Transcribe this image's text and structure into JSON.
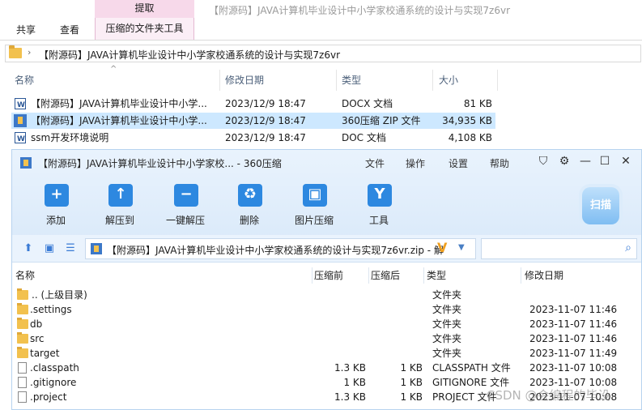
{
  "explorer": {
    "context_tab_header": "提取",
    "tabs": [
      "共享",
      "查看",
      "压缩的文件夹工具"
    ],
    "window_title": "【附源码】JAVA计算机毕业设计中小学家校通系统的设计与实现7z6vr",
    "address_path": "【附源码】JAVA计算机毕业设计中小学家校通系统的设计与实现7z6vr",
    "columns": [
      "名称",
      "修改日期",
      "类型",
      "大小"
    ],
    "files": [
      {
        "name": "【附源码】JAVA计算机毕业设计中小学...",
        "date": "2023/12/9 18:47",
        "type": "DOCX 文档",
        "size": "81 KB",
        "icon": "word-doc-icon"
      },
      {
        "name": "【附源码】JAVA计算机毕业设计中小学...",
        "date": "2023/12/9 18:47",
        "type": "360压缩 ZIP 文件",
        "size": "34,935 KB",
        "icon": "zip-archive-icon"
      },
      {
        "name": "ssm开发环境说明",
        "date": "2023/12/9 18:47",
        "type": "DOC 文档",
        "size": "4,108 KB",
        "icon": "word-doc-icon"
      }
    ]
  },
  "zip": {
    "title": "【附源码】JAVA计算机毕业设计中小学家校... - 360压缩",
    "menu": [
      "文件",
      "操作",
      "设置",
      "帮助"
    ],
    "toolbar": [
      {
        "label": "添加",
        "icon": "+"
      },
      {
        "label": "解压到",
        "icon": "↑"
      },
      {
        "label": "一键解压",
        "icon": "−"
      },
      {
        "label": "删除",
        "icon": "♻"
      },
      {
        "label": "图片压缩",
        "icon": "▣"
      },
      {
        "label": "工具",
        "icon": "Y"
      }
    ],
    "scan_label": "扫描",
    "address": "【附源码】JAVA计算机毕业设计中小学家校通系统的设计与实现7z6vr.zip - 解",
    "columns": [
      "名称",
      "压缩前",
      "压缩后",
      "类型",
      "修改日期"
    ],
    "rows": [
      {
        "name": ".. (上级目录)",
        "before": "",
        "after": "",
        "type": "文件夹",
        "date": "",
        "kind": "folder"
      },
      {
        "name": ".settings",
        "before": "",
        "after": "",
        "type": "文件夹",
        "date": "2023-11-07 11:46",
        "kind": "folder"
      },
      {
        "name": "db",
        "before": "",
        "after": "",
        "type": "文件夹",
        "date": "2023-11-07 11:46",
        "kind": "folder"
      },
      {
        "name": "src",
        "before": "",
        "after": "",
        "type": "文件夹",
        "date": "2023-11-07 11:46",
        "kind": "folder"
      },
      {
        "name": "target",
        "before": "",
        "after": "",
        "type": "文件夹",
        "date": "2023-11-07 11:49",
        "kind": "folder"
      },
      {
        "name": ".classpath",
        "before": "1.3 KB",
        "after": "1 KB",
        "type": "CLASSPATH 文件",
        "date": "2023-11-07 10:08",
        "kind": "file"
      },
      {
        "name": ".gitignore",
        "before": "1 KB",
        "after": "1 KB",
        "type": "GITIGNORE 文件",
        "date": "2023-11-07 10:08",
        "kind": "file"
      },
      {
        "name": ".project",
        "before": "1.3 KB",
        "after": "1 KB",
        "type": "PROJECT 文件",
        "date": "2023-11-07 10:08",
        "kind": "file"
      }
    ]
  },
  "watermark": "CSDN @会编程的毕设"
}
